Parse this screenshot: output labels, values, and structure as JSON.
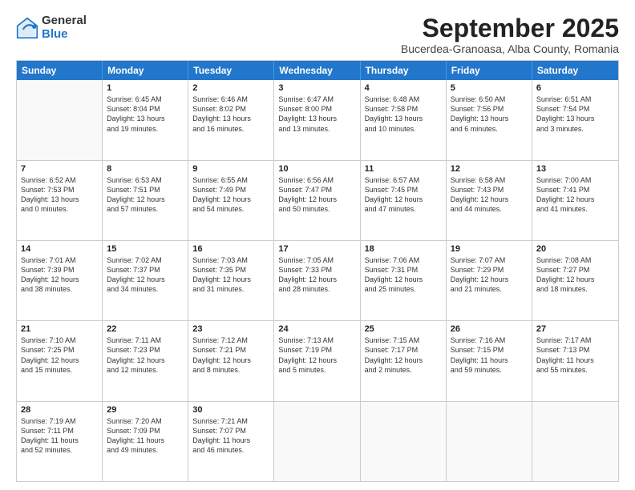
{
  "logo": {
    "general": "General",
    "blue": "Blue"
  },
  "title": {
    "month": "September 2025",
    "location": "Bucerdea-Granoasa, Alba County, Romania"
  },
  "header_days": [
    "Sunday",
    "Monday",
    "Tuesday",
    "Wednesday",
    "Thursday",
    "Friday",
    "Saturday"
  ],
  "weeks": [
    [
      {
        "day": "",
        "info": ""
      },
      {
        "day": "1",
        "info": "Sunrise: 6:45 AM\nSunset: 8:04 PM\nDaylight: 13 hours\nand 19 minutes."
      },
      {
        "day": "2",
        "info": "Sunrise: 6:46 AM\nSunset: 8:02 PM\nDaylight: 13 hours\nand 16 minutes."
      },
      {
        "day": "3",
        "info": "Sunrise: 6:47 AM\nSunset: 8:00 PM\nDaylight: 13 hours\nand 13 minutes."
      },
      {
        "day": "4",
        "info": "Sunrise: 6:48 AM\nSunset: 7:58 PM\nDaylight: 13 hours\nand 10 minutes."
      },
      {
        "day": "5",
        "info": "Sunrise: 6:50 AM\nSunset: 7:56 PM\nDaylight: 13 hours\nand 6 minutes."
      },
      {
        "day": "6",
        "info": "Sunrise: 6:51 AM\nSunset: 7:54 PM\nDaylight: 13 hours\nand 3 minutes."
      }
    ],
    [
      {
        "day": "7",
        "info": "Sunrise: 6:52 AM\nSunset: 7:53 PM\nDaylight: 13 hours\nand 0 minutes."
      },
      {
        "day": "8",
        "info": "Sunrise: 6:53 AM\nSunset: 7:51 PM\nDaylight: 12 hours\nand 57 minutes."
      },
      {
        "day": "9",
        "info": "Sunrise: 6:55 AM\nSunset: 7:49 PM\nDaylight: 12 hours\nand 54 minutes."
      },
      {
        "day": "10",
        "info": "Sunrise: 6:56 AM\nSunset: 7:47 PM\nDaylight: 12 hours\nand 50 minutes."
      },
      {
        "day": "11",
        "info": "Sunrise: 6:57 AM\nSunset: 7:45 PM\nDaylight: 12 hours\nand 47 minutes."
      },
      {
        "day": "12",
        "info": "Sunrise: 6:58 AM\nSunset: 7:43 PM\nDaylight: 12 hours\nand 44 minutes."
      },
      {
        "day": "13",
        "info": "Sunrise: 7:00 AM\nSunset: 7:41 PM\nDaylight: 12 hours\nand 41 minutes."
      }
    ],
    [
      {
        "day": "14",
        "info": "Sunrise: 7:01 AM\nSunset: 7:39 PM\nDaylight: 12 hours\nand 38 minutes."
      },
      {
        "day": "15",
        "info": "Sunrise: 7:02 AM\nSunset: 7:37 PM\nDaylight: 12 hours\nand 34 minutes."
      },
      {
        "day": "16",
        "info": "Sunrise: 7:03 AM\nSunset: 7:35 PM\nDaylight: 12 hours\nand 31 minutes."
      },
      {
        "day": "17",
        "info": "Sunrise: 7:05 AM\nSunset: 7:33 PM\nDaylight: 12 hours\nand 28 minutes."
      },
      {
        "day": "18",
        "info": "Sunrise: 7:06 AM\nSunset: 7:31 PM\nDaylight: 12 hours\nand 25 minutes."
      },
      {
        "day": "19",
        "info": "Sunrise: 7:07 AM\nSunset: 7:29 PM\nDaylight: 12 hours\nand 21 minutes."
      },
      {
        "day": "20",
        "info": "Sunrise: 7:08 AM\nSunset: 7:27 PM\nDaylight: 12 hours\nand 18 minutes."
      }
    ],
    [
      {
        "day": "21",
        "info": "Sunrise: 7:10 AM\nSunset: 7:25 PM\nDaylight: 12 hours\nand 15 minutes."
      },
      {
        "day": "22",
        "info": "Sunrise: 7:11 AM\nSunset: 7:23 PM\nDaylight: 12 hours\nand 12 minutes."
      },
      {
        "day": "23",
        "info": "Sunrise: 7:12 AM\nSunset: 7:21 PM\nDaylight: 12 hours\nand 8 minutes."
      },
      {
        "day": "24",
        "info": "Sunrise: 7:13 AM\nSunset: 7:19 PM\nDaylight: 12 hours\nand 5 minutes."
      },
      {
        "day": "25",
        "info": "Sunrise: 7:15 AM\nSunset: 7:17 PM\nDaylight: 12 hours\nand 2 minutes."
      },
      {
        "day": "26",
        "info": "Sunrise: 7:16 AM\nSunset: 7:15 PM\nDaylight: 11 hours\nand 59 minutes."
      },
      {
        "day": "27",
        "info": "Sunrise: 7:17 AM\nSunset: 7:13 PM\nDaylight: 11 hours\nand 55 minutes."
      }
    ],
    [
      {
        "day": "28",
        "info": "Sunrise: 7:19 AM\nSunset: 7:11 PM\nDaylight: 11 hours\nand 52 minutes."
      },
      {
        "day": "29",
        "info": "Sunrise: 7:20 AM\nSunset: 7:09 PM\nDaylight: 11 hours\nand 49 minutes."
      },
      {
        "day": "30",
        "info": "Sunrise: 7:21 AM\nSunset: 7:07 PM\nDaylight: 11 hours\nand 46 minutes."
      },
      {
        "day": "",
        "info": ""
      },
      {
        "day": "",
        "info": ""
      },
      {
        "day": "",
        "info": ""
      },
      {
        "day": "",
        "info": ""
      }
    ]
  ]
}
